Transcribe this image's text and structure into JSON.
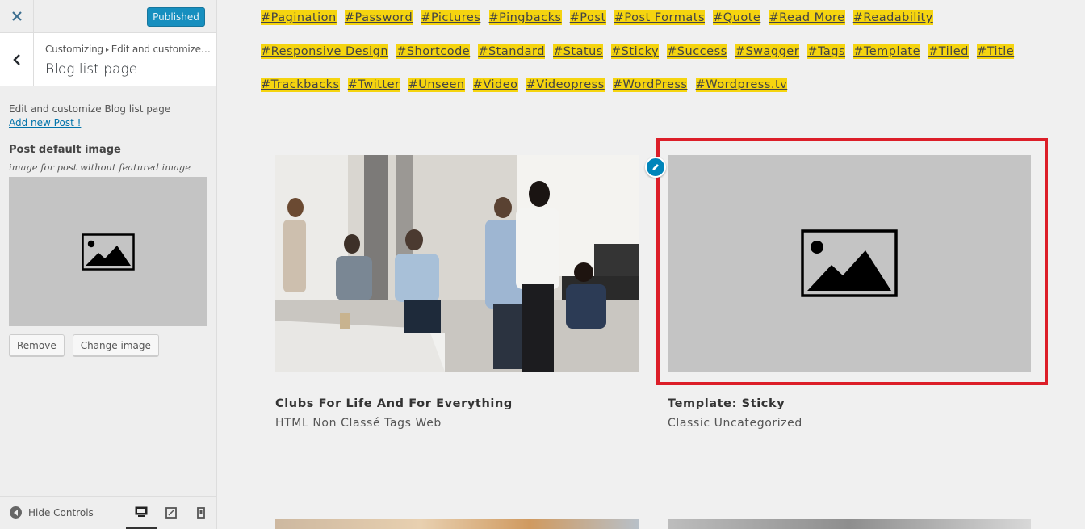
{
  "header": {
    "publish_label": "Published"
  },
  "panel": {
    "breadcrumb_root": "Customizing",
    "breadcrumb_section": "Edit and customize p...",
    "title": "Blog list page",
    "description": "Edit and customize Blog list page",
    "add_post_link": "Add new Post !",
    "control_label": "Post default image",
    "control_description": "image for post without featured image",
    "remove_label": "Remove",
    "change_label": "Change image"
  },
  "footer": {
    "hide_controls_label": "Hide Controls"
  },
  "tags": [
    "#Pagination",
    "#Password",
    "#Pictures",
    "#Pingbacks",
    "#Post",
    "#Post Formats",
    "#Quote",
    "#Read More",
    "#Readability",
    "#Responsive Design",
    "#Shortcode",
    "#Standard",
    "#Status",
    "#Sticky",
    "#Success",
    "#Swagger",
    "#Tags",
    "#Template",
    "#Tiled",
    "#Title",
    "#Trackbacks",
    "#Twitter",
    "#Unseen",
    "#Video",
    "#Videopress",
    "#WordPress",
    "#Wordpress.tv"
  ],
  "posts": [
    {
      "title": "Clubs For Life And For Everything",
      "categories": [
        "HTML",
        "Non Classé",
        "Tags",
        "Web"
      ]
    },
    {
      "title": "Template: Sticky",
      "categories": [
        "Classic",
        "Uncategorized"
      ]
    }
  ],
  "colors": {
    "tag_bg": "#f5d40f",
    "primary": "#0085ba",
    "highlight": "#dc1e28"
  }
}
